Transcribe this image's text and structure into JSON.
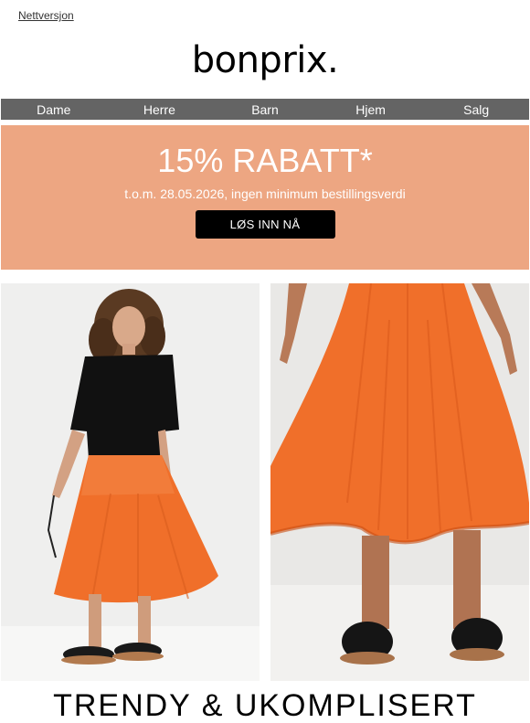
{
  "header": {
    "web_version_link": "Nettversjon",
    "logo_text": "bonprix."
  },
  "nav": {
    "items": [
      {
        "label": "Dame"
      },
      {
        "label": "Herre"
      },
      {
        "label": "Barn"
      },
      {
        "label": "Hjem"
      },
      {
        "label": "Salg"
      }
    ],
    "background": "#646464"
  },
  "promo": {
    "title": "15% RABATT*",
    "subtitle": "t.o.m. 28.05.2026, ingen minimum bestillingsverdi",
    "button_label": "LØS INN NÅ",
    "background": "#eda682"
  },
  "images": {
    "left": {
      "icon": "model-orange-skirt-full-body-photo"
    },
    "right": {
      "icon": "orange-skirt-closeup-photo"
    },
    "accent_color": "#f06f2a"
  },
  "headline": "TRENDY & UKOMPLISERT"
}
